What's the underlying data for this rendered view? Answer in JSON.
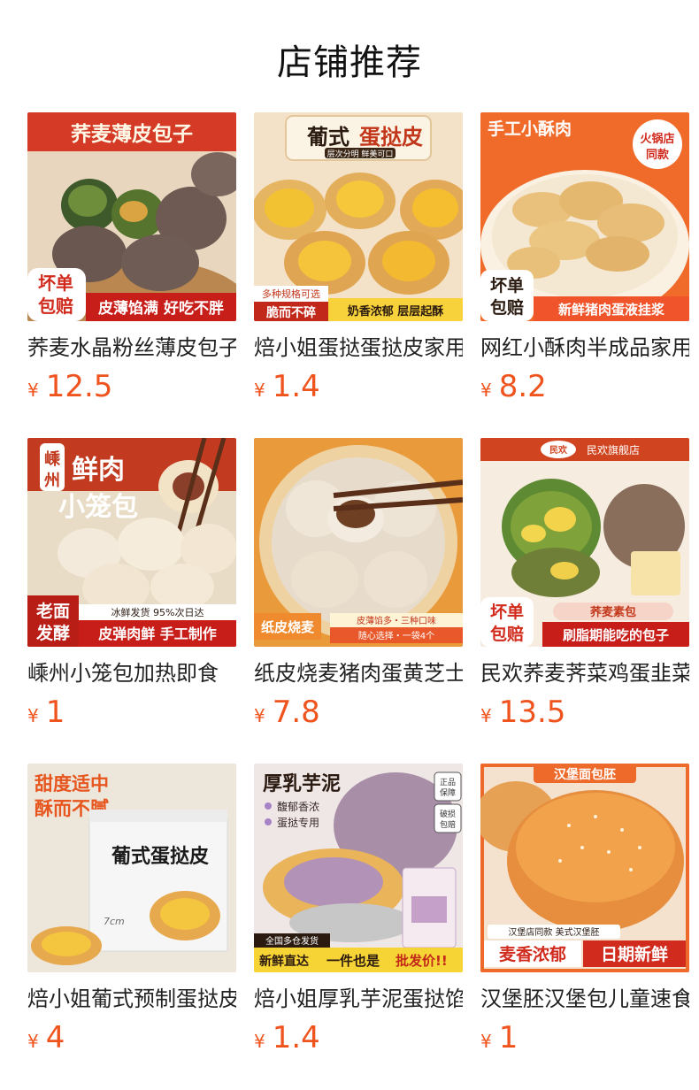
{
  "page": {
    "title": "店铺推荐"
  },
  "colors": {
    "price": "#f0541e",
    "brand_red": "#c8281e",
    "text": "#222222"
  },
  "products": [
    {
      "name": "荞麦水晶粉丝薄皮包子",
      "currency": "¥",
      "price": "12.5",
      "image": {
        "headline": "荞麦薄皮包子",
        "badge": "坏单包赔",
        "badge_top": "坏单",
        "badge_bottom": "包赔",
        "caption": "皮薄馅满 好吃不胖"
      }
    },
    {
      "name": "焙小姐蛋挞蛋挞皮家用",
      "currency": "¥",
      "price": "1.4",
      "image": {
        "headline_a": "葡式",
        "headline_b": "蛋挞皮",
        "sub": "层次分明  鲜美可口",
        "tag": "多种规格可选",
        "caption_a": "脆而不碎",
        "caption_b": "奶香浓郁 层层起酥"
      }
    },
    {
      "name": "网红小酥肉半成品家用",
      "currency": "¥",
      "price": "8.2",
      "image": {
        "headline": "手工小酥肉",
        "stamp_top": "火锅店",
        "stamp_bottom": "同款",
        "badge_top": "坏单",
        "badge_bottom": "包赔",
        "caption": "新鲜猪肉蛋液挂浆"
      }
    },
    {
      "name": "嵊州小笼包加热即食",
      "currency": "¥",
      "price": "1",
      "image": {
        "place_a": "嵊",
        "place_b": "州",
        "headline_a": "鲜肉",
        "headline_b": "小笼包",
        "badge_top": "老面",
        "badge_bottom": "发酵",
        "sub": "冰鲜发货  95%次日达",
        "caption": "皮弹肉鲜 手工制作"
      }
    },
    {
      "name": "纸皮烧麦猪肉蛋黄芝士",
      "currency": "¥",
      "price": "7.8",
      "image": {
        "tag": "纸皮烧麦",
        "sub_a": "皮薄馅多・三种口味",
        "sub_b": "随心选择・一袋4个"
      }
    },
    {
      "name": "民欢荞麦荠菜鸡蛋韭菜",
      "currency": "¥",
      "price": "13.5",
      "image": {
        "brand_logo": "民欢",
        "store": "民欢旗舰店",
        "badge_top": "坏单",
        "badge_bottom": "包赔",
        "label": "荞麦素包",
        "caption": "刷脂期能吃的包子"
      }
    },
    {
      "name": "焙小姐葡式预制蛋挞皮",
      "currency": "¥",
      "price": "4",
      "image": {
        "headline_a": "甜度适中",
        "headline_b": "酥而不腻",
        "box_text": "葡式蛋挞皮",
        "size": "7cm"
      }
    },
    {
      "name": "焙小姐厚乳芋泥蛋挞馅",
      "currency": "¥",
      "price": "1.4",
      "image": {
        "headline": "厚乳芋泥",
        "point_a": "馥郁香浓",
        "point_b": "蛋挞专用",
        "seal_a_1": "正品",
        "seal_a_2": "保障",
        "seal_b_1": "破损",
        "seal_b_2": "包赔",
        "ship": "全国多仓发货",
        "caption_a": "新鲜直达",
        "caption_b": "一件也是",
        "caption_c": "批发价!!"
      }
    },
    {
      "name": "汉堡胚汉堡包儿童速食",
      "currency": "¥",
      "price": "1",
      "image": {
        "headline": "汉堡面包胚",
        "sub": "汉堡店同款 美式汉堡胚",
        "caption_a": "麦香浓郁",
        "caption_b": "日期新鲜"
      }
    }
  ]
}
